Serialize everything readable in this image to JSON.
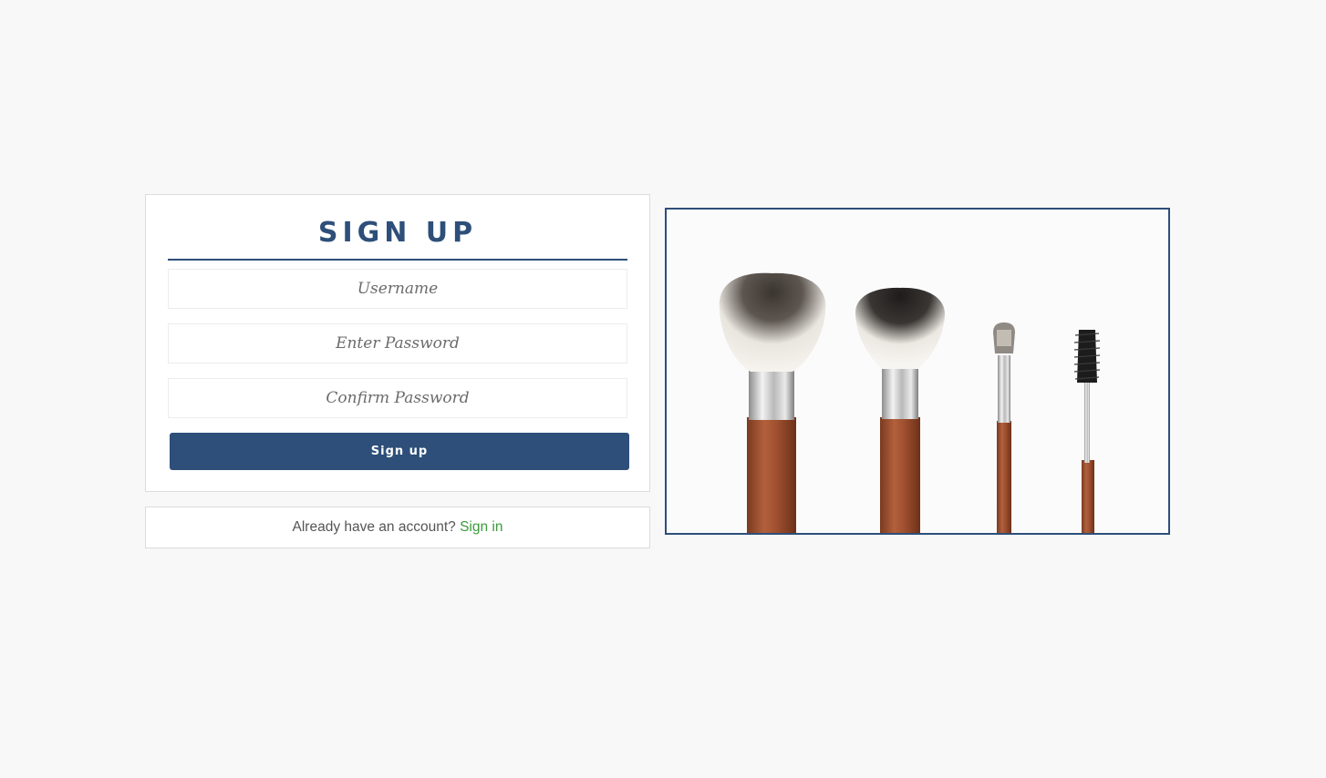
{
  "form": {
    "title": "SIGN UP",
    "username_placeholder": "Username",
    "password_placeholder": "Enter Password",
    "confirm_placeholder": "Confirm Password",
    "submit_label": "Sign up"
  },
  "signin": {
    "prompt": "Already have an account? ",
    "link_label": "Sign in"
  },
  "image": {
    "subject": "makeup brushes"
  },
  "colors": {
    "accent": "#2d4f79",
    "link": "#3a9a3a",
    "background": "#f8f8f8"
  }
}
